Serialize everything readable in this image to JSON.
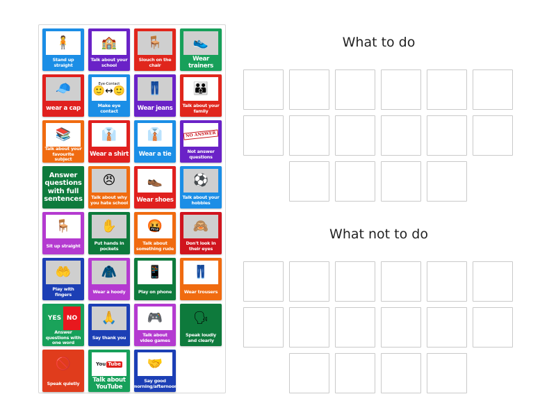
{
  "panel": {
    "cards": [
      {
        "label": "Stand up straight",
        "color": "#1b8ee6",
        "icon": "standing-person-icon",
        "glyph": "🧍",
        "style": "small"
      },
      {
        "label": "Talk about your school",
        "color": "#6a22c7",
        "icon": "school-building-icon",
        "glyph": "🏫",
        "style": "small"
      },
      {
        "label": "Slouch on the chair",
        "color": "#e0261c",
        "icon": "slouching-person-icon",
        "glyph": "🪑",
        "style": "small",
        "photo": true
      },
      {
        "label": "Wear trainers",
        "color": "#17a05a",
        "icon": "trainers-icon",
        "glyph": "👟",
        "style": "big",
        "photo": true
      },
      {
        "label": "wear a cap",
        "color": "#e0201e",
        "icon": "cap-icon",
        "glyph": "🧢",
        "style": "big",
        "photo": true
      },
      {
        "label": "Make eye contact",
        "color": "#1b8ee6",
        "icon": "eye-contact-icon",
        "glyph": "",
        "style": "small",
        "eyeText": "Eye-Contact"
      },
      {
        "label": "Wear jeans",
        "color": "#6a22c7",
        "icon": "jeans-icon",
        "glyph": "👖",
        "style": "big",
        "photo": true
      },
      {
        "label": "Talk about your family",
        "color": "#e0261c",
        "icon": "family-icon",
        "glyph": "👪",
        "style": "small"
      },
      {
        "label": "Talk about your favourite subject",
        "color": "#f06b10",
        "icon": "books-icon",
        "glyph": "📚",
        "style": "small"
      },
      {
        "label": "Wear a shirt",
        "color": "#e0201e",
        "icon": "shirt-icon",
        "glyph": "👔",
        "style": "big"
      },
      {
        "label": "Wear a tie",
        "color": "#1b8ee6",
        "icon": "tie-icon",
        "glyph": "👔",
        "style": "big"
      },
      {
        "label": "Not answer questions",
        "color": "#6a22c7",
        "icon": "no-answer-stamp-icon",
        "glyph": "",
        "style": "small",
        "stamp": "NO ANSWER"
      },
      {
        "label": "Answer questions with full sentences",
        "color": "#0e7a3c",
        "icon": "",
        "glyph": "",
        "style": "textonly"
      },
      {
        "label": "Talk about why you hate school",
        "color": "#f06b10",
        "icon": "angry-child-icon",
        "glyph": "😠",
        "style": "small",
        "photo": true
      },
      {
        "label": "Wear shoes",
        "color": "#e0201e",
        "icon": "shoes-icon",
        "glyph": "👞",
        "style": "big"
      },
      {
        "label": "Talk about your hobbies",
        "color": "#1b8ee6",
        "icon": "hobbies-icon",
        "glyph": "⚽",
        "style": "small",
        "photo": true
      },
      {
        "label": "Sit up straight",
        "color": "#b43ad0",
        "icon": "sitting-person-icon",
        "glyph": "🪑",
        "style": "small"
      },
      {
        "label": "Put hands in pockets",
        "color": "#0e7a3c",
        "icon": "hand-in-pocket-icon",
        "glyph": "✋",
        "style": "small",
        "photo": true
      },
      {
        "label": "Talk about something rude",
        "color": "#f06b10",
        "icon": "rude-boy-icon",
        "glyph": "🤬",
        "style": "small"
      },
      {
        "label": "Don't look in their eyes",
        "color": "#d0141e",
        "icon": "looking-away-icon",
        "glyph": "🙈",
        "style": "small",
        "photo": true
      },
      {
        "label": "Play with fingers",
        "color": "#1c3fb5",
        "icon": "fidgeting-hands-icon",
        "glyph": "🤲",
        "style": "small",
        "photo": true
      },
      {
        "label": "Wear a hoody",
        "color": "#b43ad0",
        "icon": "hoody-icon",
        "glyph": "🧥",
        "style": "small",
        "photo": true
      },
      {
        "label": "Play on phone",
        "color": "#0e7a3c",
        "icon": "phone-kids-icon",
        "glyph": "📱",
        "style": "small"
      },
      {
        "label": "Wear trousers",
        "color": "#f06b10",
        "icon": "trousers-icon",
        "glyph": "👖",
        "style": "small"
      },
      {
        "label": "Answer questions with one word",
        "color": "#17a05a",
        "icon": "yes-no-icon",
        "glyph": "",
        "style": "small",
        "yes": "YES",
        "no": "NO"
      },
      {
        "label": "Say thank you",
        "color": "#1c3fb5",
        "icon": "thank-you-card-icon",
        "glyph": "🙏",
        "style": "small",
        "photo": true
      },
      {
        "label": "Talk about video games",
        "color": "#b43ad0",
        "icon": "game-console-icon",
        "glyph": "🎮",
        "style": "small"
      },
      {
        "label": "Speak loudly and clearly",
        "color": "#0e7a3c",
        "icon": "speaking-head-icon",
        "glyph": "🗣",
        "style": "small",
        "noPic": true
      },
      {
        "label": "Speak quietly",
        "color": "#e03c1c",
        "icon": "no-speaking-icon",
        "glyph": "🚫",
        "style": "small",
        "noPic": true
      },
      {
        "label": "Talk about YouTube",
        "color": "#17a05a",
        "icon": "youtube-logo-icon",
        "glyph": "",
        "style": "big",
        "youtube": [
          "You",
          "Tube"
        ]
      },
      {
        "label": "Say good morning/afternoon",
        "color": "#1c3fb5",
        "icon": "greeting-icon",
        "glyph": "🤝",
        "style": "small"
      }
    ]
  },
  "groups": [
    {
      "title": "What to do",
      "slots": 16
    },
    {
      "title": "What not to do",
      "slots": 16
    }
  ]
}
